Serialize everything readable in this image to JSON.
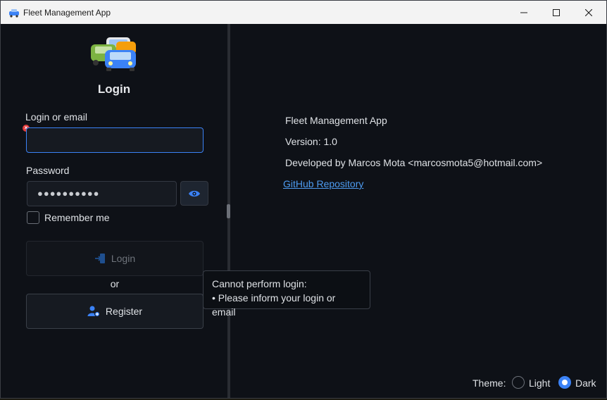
{
  "window": {
    "title": "Fleet Management App"
  },
  "left": {
    "heading": "Login",
    "login_label": "Login or email",
    "login_value": "",
    "password_label": "Password",
    "password_masked": "●●●●●●●●●●",
    "remember_label": "Remember me",
    "login_button": "Login",
    "or_text": "or",
    "register_button": "Register"
  },
  "tooltip": {
    "line1": "Cannot perform login:",
    "line2": "• Please inform your login or email"
  },
  "about": {
    "app_name": "Fleet Management App",
    "version": "Version: 1.0",
    "developer": "Developed by Marcos Mota <marcosmota5@hotmail.com>",
    "repo_link": "GitHub Repository"
  },
  "theme": {
    "label": "Theme:",
    "options": [
      "Light",
      "Dark"
    ],
    "selected": "Dark"
  },
  "colors": {
    "accent": "#3b82f6",
    "link": "#4d9bf0",
    "background": "#0e1117",
    "error": "#e23b3b"
  }
}
